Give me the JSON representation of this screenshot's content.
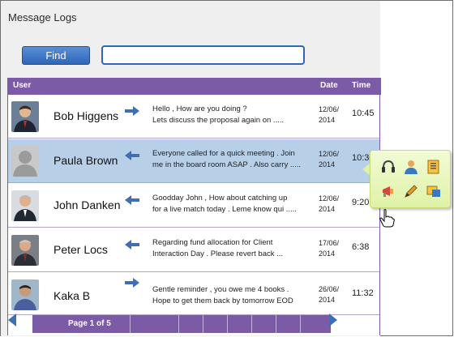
{
  "app": {
    "title": "Message Logs"
  },
  "search": {
    "button_label": "Find",
    "value": "",
    "placeholder": ""
  },
  "table": {
    "columns": [
      "User",
      "Date",
      "Time"
    ],
    "rows": [
      {
        "name": "Bob Higgens",
        "direction": "outgoing",
        "message_line1": "Hello , How are you doing ?",
        "message_line2": "Lets discuss the proposal again on  .....",
        "date_line1": "12/06/",
        "date_line2": "2014",
        "time": "10:45",
        "selected": false
      },
      {
        "name": "Paula Brown",
        "direction": "incoming",
        "message_line1": "Everyone called for a quick meeting . Join",
        "message_line2": "me in the board room ASAP . Also carry .....",
        "date_line1": "12/06/",
        "date_line2": "2014",
        "time": "10:30",
        "selected": true
      },
      {
        "name": "John Danken",
        "direction": "incoming",
        "message_line1": "Goodday John ,  How about catching up",
        "message_line2": "for a live match today . Leme know qui  .....",
        "date_line1": "12/06/",
        "date_line2": "2014",
        "time": "9:20",
        "selected": false
      },
      {
        "name": "Peter Locs",
        "direction": "incoming",
        "message_line1": "Regarding fund allocation for Client",
        "message_line2": "Interaction Day . Please revert back ...",
        "date_line1": "17/06/",
        "date_line2": "2014",
        "time": "6:38",
        "selected": false
      },
      {
        "name": "Kaka  B",
        "direction": "outgoing",
        "message_line1": "Gentle reminder , you owe me 4 books .",
        "message_line2": "Hope to get them back by tomorrow  EOD",
        "date_line1": "26/06/",
        "date_line2": "2014",
        "time": "11:32",
        "selected": false
      }
    ]
  },
  "pagination": {
    "label": "Page 1 of 5"
  },
  "context_popup": {
    "icons": [
      "headset-icon",
      "person-icon",
      "document-icon",
      "megaphone-icon",
      "pen-icon",
      "message-icon"
    ]
  },
  "colors": {
    "header": "#7b5aa6",
    "selected_row": "#b8cfe8",
    "button": "#2f66b8",
    "popup": "#dff2a6"
  }
}
